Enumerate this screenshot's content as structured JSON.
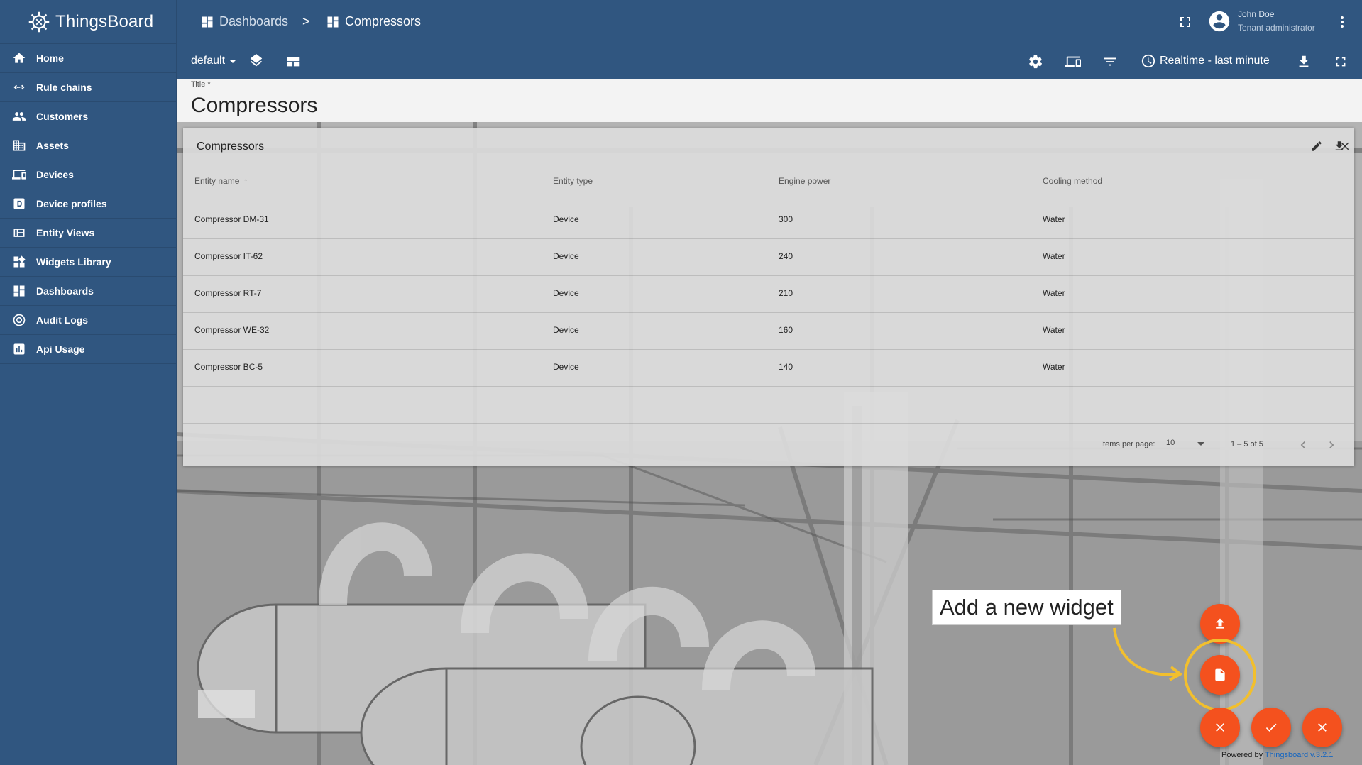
{
  "app": {
    "name": "ThingsBoard"
  },
  "sidebar": {
    "items": [
      {
        "label": "Home",
        "icon": "home-icon"
      },
      {
        "label": "Rule chains",
        "icon": "rule-chains-icon"
      },
      {
        "label": "Customers",
        "icon": "customers-icon"
      },
      {
        "label": "Assets",
        "icon": "assets-icon"
      },
      {
        "label": "Devices",
        "icon": "devices-icon"
      },
      {
        "label": "Device profiles",
        "icon": "device-profiles-icon"
      },
      {
        "label": "Entity Views",
        "icon": "entity-views-icon"
      },
      {
        "label": "Widgets Library",
        "icon": "widgets-icon"
      },
      {
        "label": "Dashboards",
        "icon": "dashboards-icon"
      },
      {
        "label": "Audit Logs",
        "icon": "audit-logs-icon"
      },
      {
        "label": "Api Usage",
        "icon": "api-usage-icon"
      }
    ]
  },
  "header": {
    "breadcrumb": [
      "Dashboards",
      "Compressors"
    ],
    "separator": ">",
    "user": {
      "name": "John Doe",
      "role": "Tenant administrator"
    }
  },
  "toolbar": {
    "state": "default",
    "timewindow": "Realtime - last minute"
  },
  "titlebar": {
    "label": "Title *",
    "value": "Compressors"
  },
  "widget": {
    "title": "Compressors",
    "columns": [
      "Entity name",
      "Entity type",
      "Engine power",
      "Cooling method"
    ],
    "sort_arrow": "↑",
    "rows": [
      [
        "Compressor DM-31",
        "Device",
        "300",
        "Water"
      ],
      [
        "Compressor IT-62",
        "Device",
        "240",
        "Water"
      ],
      [
        "Compressor RT-7",
        "Device",
        "210",
        "Water"
      ],
      [
        "Compressor WE-32",
        "Device",
        "160",
        "Water"
      ],
      [
        "Compressor BC-5",
        "Device",
        "140",
        "Water"
      ]
    ],
    "pager": {
      "items_label": "Items per page:",
      "items_value": "10",
      "range": "1 – 5 of 5"
    }
  },
  "callout": {
    "text": "Add a new widget"
  },
  "footer": {
    "powered_prefix": "Powered by ",
    "powered_link": "Thingsboard v.3.2.1"
  },
  "colors": {
    "primary": "#305680",
    "fab": "#f4511e",
    "highlight": "#f2bf2d"
  }
}
